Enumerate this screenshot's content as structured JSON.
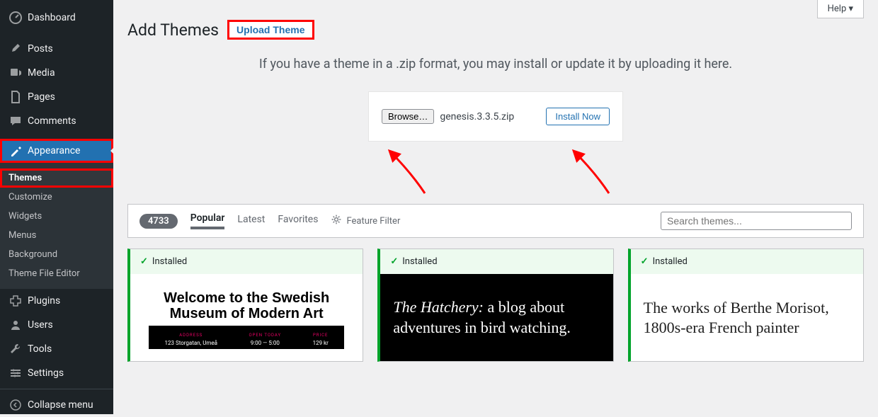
{
  "help_label": "Help ▾",
  "page_title": "Add Themes",
  "upload_theme_btn": "Upload Theme",
  "upload_help_text": "If you have a theme in a .zip format, you may install or update it by uploading it here.",
  "browse_label": "Browse…",
  "file_name": "genesis.3.3.5.zip",
  "install_now_label": "Install Now",
  "sidebar": [
    {
      "icon": "dashboard",
      "label": "Dashboard"
    },
    {
      "icon": "pin",
      "label": "Posts"
    },
    {
      "icon": "media",
      "label": "Media"
    },
    {
      "icon": "pages",
      "label": "Pages"
    },
    {
      "icon": "comments",
      "label": "Comments"
    },
    {
      "icon": "appearance",
      "label": "Appearance",
      "active": true
    },
    {
      "icon": "plugins",
      "label": "Plugins"
    },
    {
      "icon": "users",
      "label": "Users"
    },
    {
      "icon": "tools",
      "label": "Tools"
    },
    {
      "icon": "settings",
      "label": "Settings"
    },
    {
      "icon": "collapse",
      "label": "Collapse menu"
    }
  ],
  "appearance_sub": [
    "Themes",
    "Customize",
    "Widgets",
    "Menus",
    "Background",
    "Theme File Editor"
  ],
  "count": "4733",
  "filters": [
    "Popular",
    "Latest",
    "Favorites"
  ],
  "feature_filter": "Feature Filter",
  "search_placeholder": "Search themes...",
  "installed_label": "Installed",
  "previews": {
    "p1_title_l1": "Welcome to the Swedish",
    "p1_title_l2": "Museum of Modern Art",
    "p1_c1_lbl": "ADDRESS",
    "p1_c1_val": "123 Storgatan, Umeå",
    "p1_c2_lbl": "OPEN TODAY",
    "p1_c2_val": "9:00 — 5:00",
    "p1_c3_lbl": "PRICE",
    "p1_c3_val": "129 kr",
    "p2_html_i": "The Hatchery:",
    "p2_rest": " a blog about adventures in bird watching.",
    "p3": "The works of Berthe Morisot, 1800s-era French painter"
  }
}
